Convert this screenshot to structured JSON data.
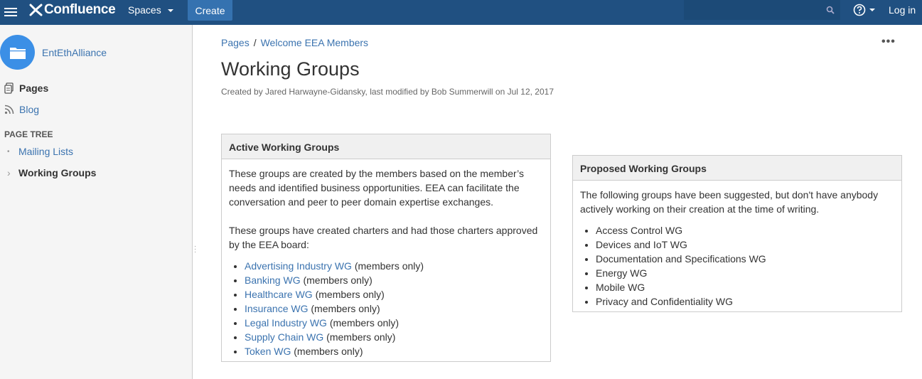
{
  "header": {
    "logo_text": "Confluence",
    "spaces_label": "Spaces",
    "create_label": "Create",
    "search_placeholder": "",
    "login_label": "Log in",
    "brand_color": "#205081"
  },
  "sidebar": {
    "space_name": "EntEthAlliance",
    "nav": {
      "pages_label": "Pages",
      "blog_label": "Blog"
    },
    "page_tree_heading": "PAGE TREE",
    "tree_items": [
      {
        "label": "Mailing Lists",
        "marker": "•"
      },
      {
        "label": "Working Groups",
        "marker": "›"
      }
    ]
  },
  "page": {
    "breadcrumb": [
      {
        "label": "Pages"
      },
      {
        "label": "Welcome EEA Members"
      }
    ],
    "breadcrumb_sep": "/",
    "title": "Working Groups",
    "byline": "Created by Jared Harwayne-Gidansky, last modified by Bob Summerwill on Jul 12, 2017"
  },
  "active_panel": {
    "title": "Active Working Groups",
    "para1": "These groups are created by the members based on the member’s needs and identified business opportunities. EEA can facilitate the conversation and peer to peer domain expertise exchanges.",
    "para2": "These groups have created charters and had those charters approved by the EEA board:",
    "items": [
      {
        "link": "Advertising Industry WG",
        "suffix": " (members only)"
      },
      {
        "link": "Banking WG",
        "suffix": " (members only)"
      },
      {
        "link": "Healthcare WG",
        "suffix": " (members only)"
      },
      {
        "link": "Insurance WG",
        "suffix": " (members only)"
      },
      {
        "link": "Legal Industry WG",
        "suffix": " (members only)"
      },
      {
        "link": "Supply Chain WG",
        "suffix": " (members only)"
      },
      {
        "link": "Token WG",
        "suffix": " (members only)"
      }
    ]
  },
  "proposed_panel": {
    "title": "Proposed Working Groups",
    "para1": "The following groups have been suggested, but don't have anybody actively working on their creation at the time of writing.",
    "items": [
      "Access Control WG",
      "Devices and IoT WG",
      "Documentation and Specifications WG",
      "Energy WG",
      "Mobile WG",
      "Privacy and Confidentiality WG"
    ]
  }
}
